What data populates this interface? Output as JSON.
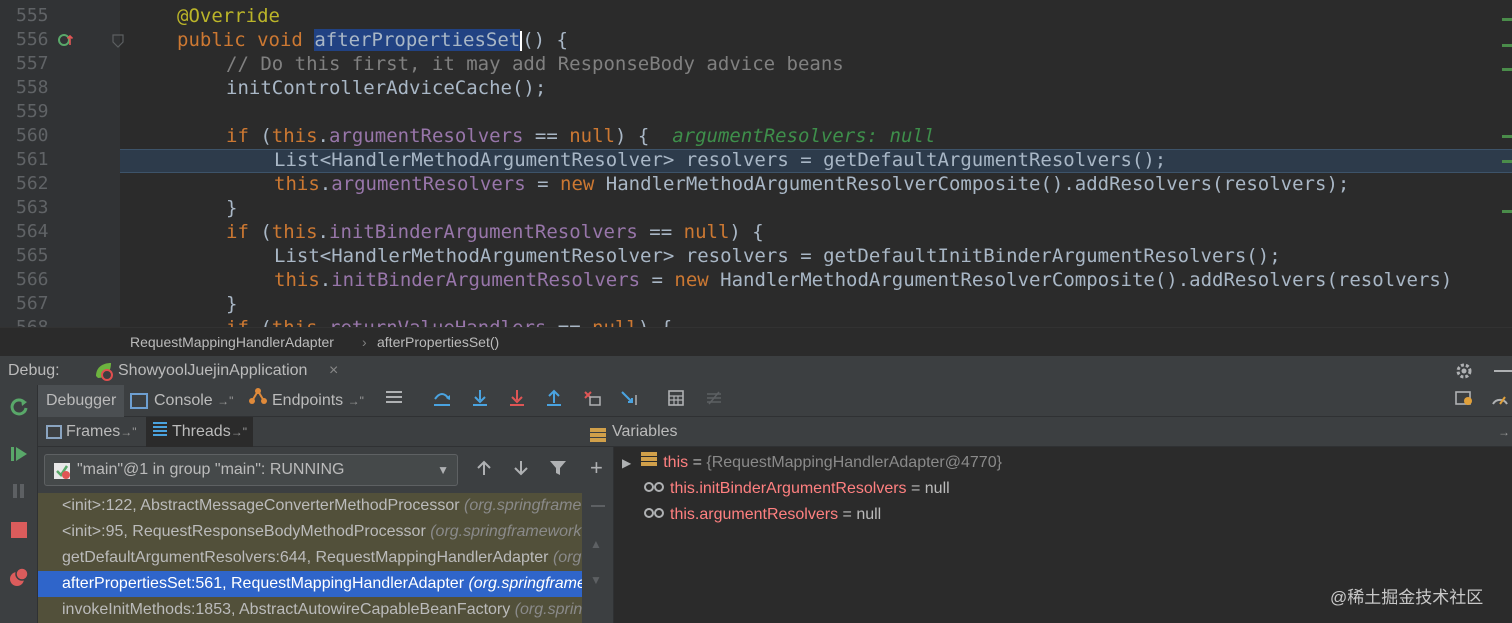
{
  "editor": {
    "line_numbers": [
      "555",
      "556",
      "557",
      "558",
      "559",
      "560",
      "561",
      "562",
      "563",
      "564",
      "565",
      "566",
      "567",
      "568"
    ],
    "lines": {
      "l555": {
        "annotation": "@Override"
      },
      "l556": {
        "kw1": "public",
        "kw2": "void",
        "method": "afterPropertiesSet",
        "rest": "() {"
      },
      "l557": {
        "comment": "// Do this first, it may add ResponseBody advice beans"
      },
      "l558": {
        "text": "initControllerAdviceCache();"
      },
      "l560": {
        "kw_if": "if",
        "open": " (",
        "this": "this",
        "dot": ".",
        "field": "argumentResolvers",
        "op": " == ",
        "null": "null",
        "close": ") {",
        "inline_hint": "argumentResolvers: null"
      },
      "l561": {
        "text": "List<HandlerMethodArgumentResolver> resolvers = getDefaultArgumentResolvers();"
      },
      "l562": {
        "this": "this",
        "dot": ".",
        "field": "argumentResolvers",
        "op": " = ",
        "new": "new",
        "rest": " HandlerMethodArgumentResolverComposite().addResolvers(resolvers);"
      },
      "l563": {
        "text": "}"
      },
      "l564": {
        "kw_if": "if",
        "open": " (",
        "this": "this",
        "dot": ".",
        "field": "initBinderArgumentResolvers",
        "op": " == ",
        "null": "null",
        "close": ") {"
      },
      "l565": {
        "text": "List<HandlerMethodArgumentResolver> resolvers = getDefaultInitBinderArgumentResolvers();"
      },
      "l566": {
        "this": "this",
        "dot": ".",
        "field": "initBinderArgumentResolvers",
        "op": " = ",
        "new": "new",
        "rest": " HandlerMethodArgumentResolverComposite().addResolvers(resolvers)"
      },
      "l567": {
        "text": "}"
      },
      "l568": {
        "kw_if": "if",
        "open": " (",
        "this": "this",
        "dot": ".",
        "field": "returnValueHandlers",
        "op": " == ",
        "null": "null",
        "close": ") {"
      }
    }
  },
  "breadcrumb": {
    "class_name": "RequestMappingHandlerAdapter",
    "separator": "›",
    "method_name": "afterPropertiesSet()"
  },
  "debug": {
    "label": "Debug:",
    "config_name": "ShowyoolJuejinApplication",
    "close_label": "×",
    "tabs": {
      "debugger": "Debugger",
      "console": "Console",
      "endpoints": "Endpoints"
    },
    "pin_glyph": "→\""
  },
  "frames": {
    "tab_frames": "Frames",
    "tab_threads": "Threads",
    "thread_select": "\"main\"@1 in group \"main\": RUNNING",
    "items": [
      {
        "method": "<init>:122, AbstractMessageConverterMethodProcessor ",
        "pkg": "(org.springframework.web.servlet.mvc.method.annotation)"
      },
      {
        "method": "<init>:95, RequestResponseBodyMethodProcessor ",
        "pkg": "(org.springframework.web.servlet.mvc.method.annotation)"
      },
      {
        "method": "getDefaultArgumentResolvers:644, RequestMappingHandlerAdapter ",
        "pkg": "(org.springframework.web.servlet.mvc.method.annotation)"
      },
      {
        "method": "afterPropertiesSet:561, RequestMappingHandlerAdapter ",
        "pkg": "(org.springframework.web.servlet.mvc.method.annotation)"
      },
      {
        "method": "invokeInitMethods:1853, AbstractAutowireCapableBeanFactory ",
        "pkg": "(org.springframework.beans.factory.support)"
      }
    ]
  },
  "variables": {
    "title": "Variables",
    "items": [
      {
        "name": "this",
        "eq": " = ",
        "value": "{RequestMappingHandlerAdapter@4770}"
      },
      {
        "name": "this.initBinderArgumentResolvers",
        "eq": " = ",
        "value": "null"
      },
      {
        "name": "this.argumentResolvers",
        "eq": " = ",
        "value": "null"
      }
    ]
  },
  "watermark": "@稀土掘金技术社区",
  "colors": {
    "selection": "#2f65ca",
    "keyword": "#cc7832",
    "field": "#9876aa",
    "var_name": "#ff8080"
  }
}
